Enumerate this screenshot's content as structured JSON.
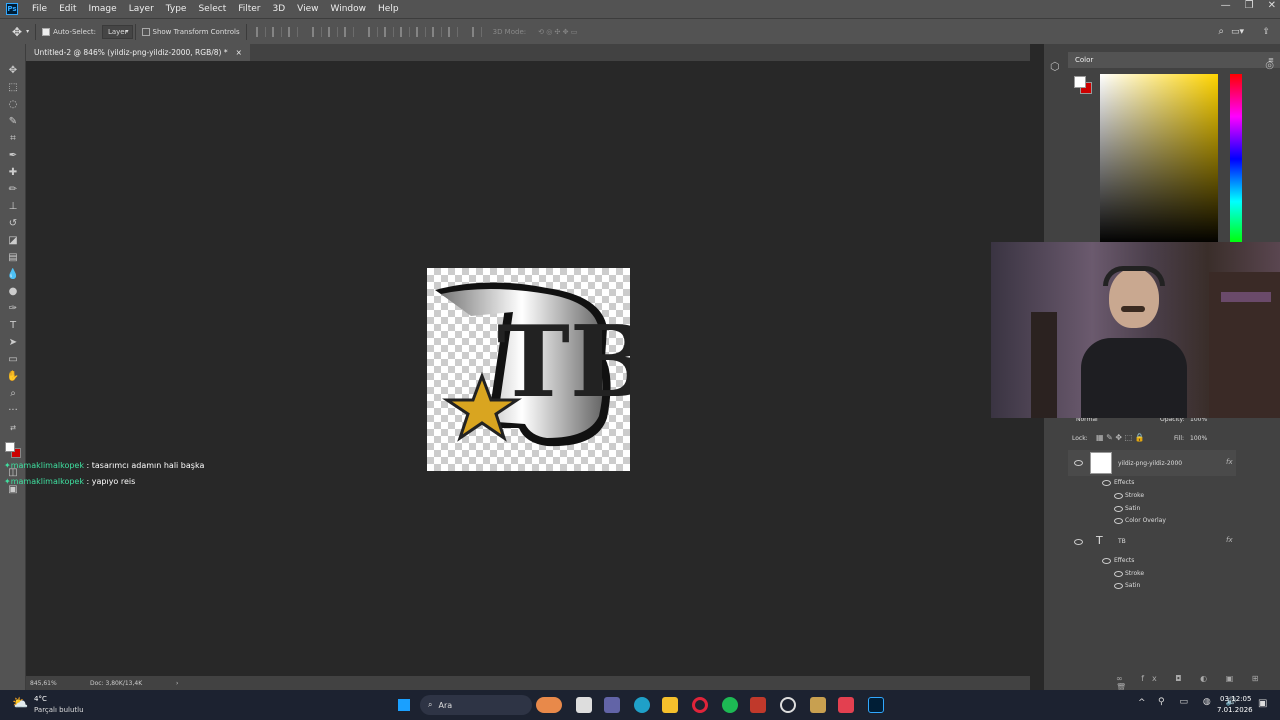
{
  "app": {
    "logo": "Ps"
  },
  "menu": [
    "File",
    "Edit",
    "Image",
    "Layer",
    "Type",
    "Select",
    "Filter",
    "3D",
    "View",
    "Window",
    "Help"
  ],
  "window_controls": {
    "minimize": "—",
    "restore": "❐",
    "close": "✕"
  },
  "options_bar": {
    "auto_select_label": "Auto-Select:",
    "auto_select_value": "Layer",
    "transform_label": "Show Transform Controls",
    "mode_3d": "3D Mode:"
  },
  "document_tab": {
    "title": "Untitled-2 @ 846% (yildiz-png-yildiz-2000, RGB/8) *",
    "close": "×"
  },
  "document": {
    "logo_text": "TB"
  },
  "status_bar": {
    "zoom": "845,61%",
    "doc": "Doc: 3,80K/13,4K",
    "arrow": "›"
  },
  "chat": [
    {
      "user": "mamaklimalkopek",
      "message": ": tasarımcı adamın hali başka"
    },
    {
      "user": "mamaklimalkopek",
      "message": ": yapıyo reis"
    }
  ],
  "color_panel": {
    "tab": "Color",
    "foreground": "#ffffff",
    "background": "#cc0000"
  },
  "layers_panel": {
    "blend_mode": "Normal",
    "opacity_label": "Opacity:",
    "opacity_value": "100%",
    "lock_label": "Lock:",
    "fill_label": "Fill:",
    "fill_value": "100%",
    "layers": [
      {
        "name": "yildiz-png-yildiz-2000",
        "type": "smart-object",
        "fx": "fx",
        "effects_label": "Effects",
        "effects": [
          "Stroke",
          "Satin",
          "Color Overlay"
        ]
      },
      {
        "name": "TB",
        "type": "text",
        "fx": "fx",
        "effects_label": "Effects",
        "effects": [
          "Stroke",
          "Satin"
        ]
      }
    ]
  },
  "taskbar": {
    "weather_temp": "4°C",
    "weather_desc": "Parçalı bulutlu",
    "search_placeholder": "Ara",
    "time": "03:12:05",
    "date": "7.01.2026",
    "tray_arrow": "^"
  },
  "colors": {
    "menubar": "#535353",
    "canvas": "#282828",
    "panel": "#424242",
    "accent": "#31a8ff",
    "chat_user": "#3fe0a0"
  }
}
